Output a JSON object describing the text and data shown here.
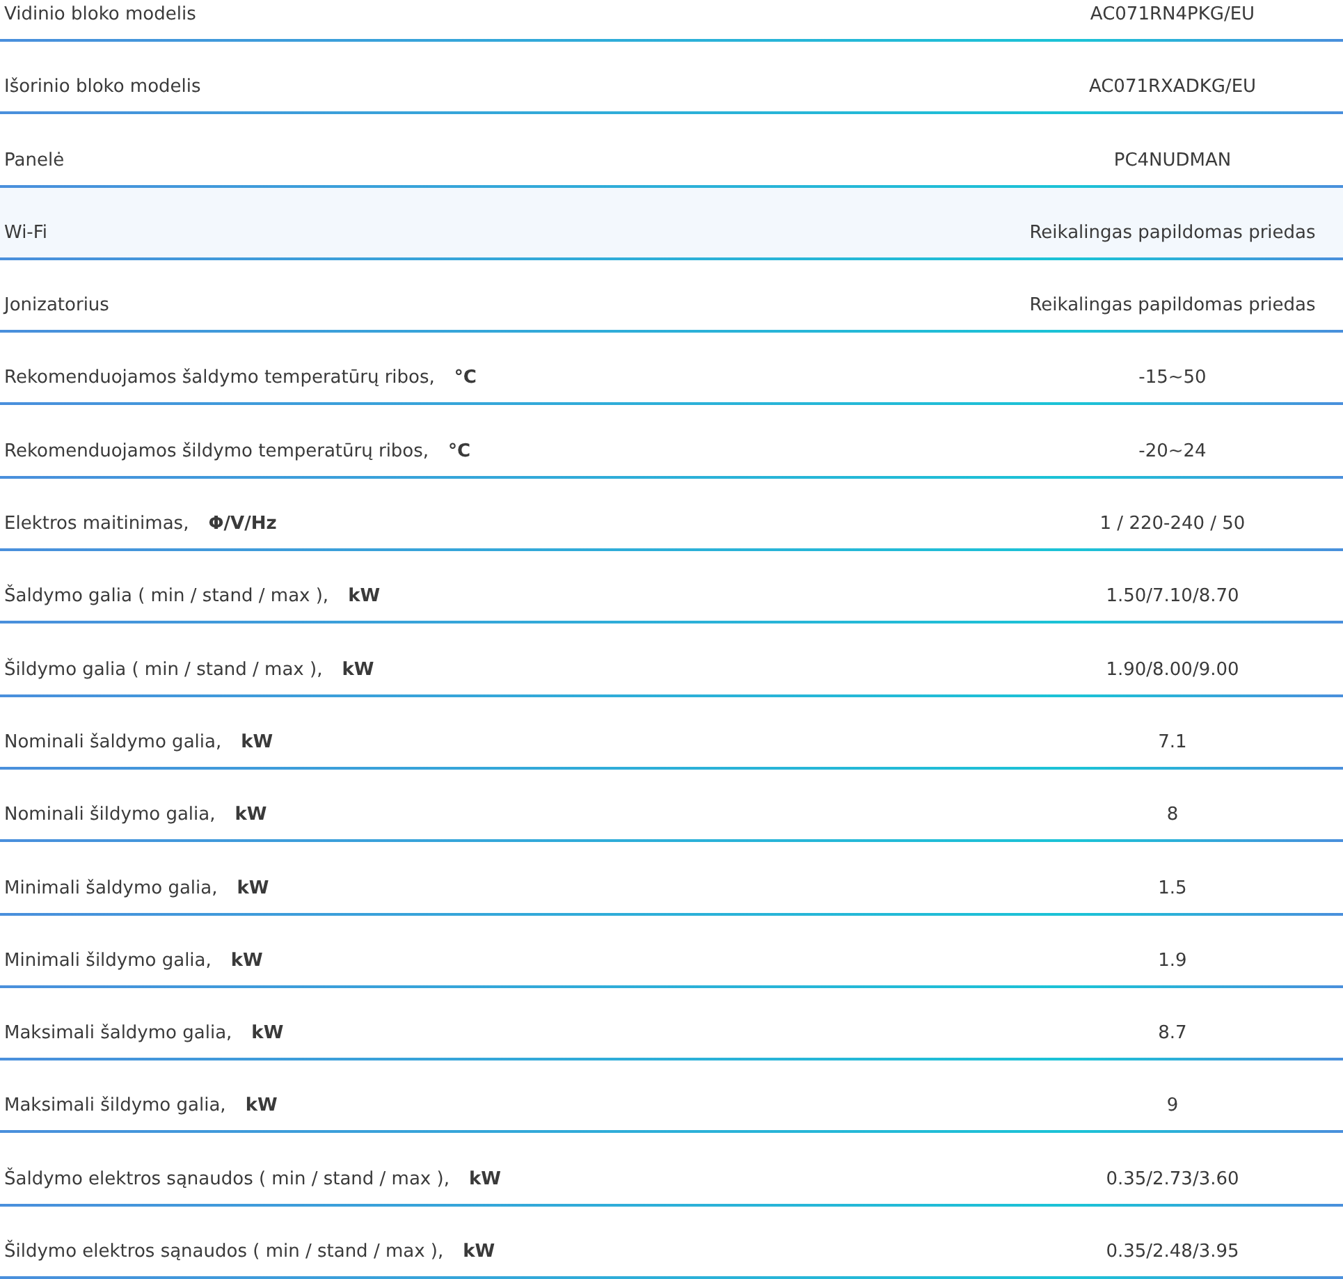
{
  "specs": [
    {
      "label": "Vidinio bloko modelis",
      "value": "AC071RN4PKG/EU",
      "highlighted": false
    },
    {
      "label": "Išorinio bloko modelis",
      "value": "AC071RXADKG/EU",
      "highlighted": false
    },
    {
      "label": "Panelė",
      "value": "PC4NUDMAN",
      "highlighted": false
    },
    {
      "label": "Wi-Fi",
      "value": "Reikalingas papildomas priedas",
      "highlighted": true
    },
    {
      "label": "Jonizatorius",
      "value": "Reikalingas papildomas priedas",
      "highlighted": false
    },
    {
      "label": "Rekomenduojamos šaldymo temperatūrų ribos,",
      "unit": "°C",
      "value": "-15~50",
      "highlighted": false
    },
    {
      "label": "Rekomenduojamos šildymo temperatūrų ribos,",
      "unit": "°C",
      "value": "-20~24",
      "highlighted": false
    },
    {
      "label": "Elektros maitinimas,",
      "unit": "Φ/V/Hz",
      "value": "1 / 220-240 / 50",
      "highlighted": false
    },
    {
      "label": "Šaldymo galia ( min / stand / max ),",
      "unit": "kW",
      "value": "1.50/7.10/8.70",
      "highlighted": false
    },
    {
      "label": "Šildymo galia ( min / stand / max ),",
      "unit": "kW",
      "value": "1.90/8.00/9.00",
      "highlighted": false
    },
    {
      "label": "Nominali šaldymo galia,",
      "unit": "kW",
      "value": "7.1",
      "highlighted": false
    },
    {
      "label": "Nominali šildymo galia,",
      "unit": "kW",
      "value": "8",
      "highlighted": false
    },
    {
      "label": "Minimali šaldymo galia,",
      "unit": "kW",
      "value": "1.5",
      "highlighted": false
    },
    {
      "label": "Minimali šildymo galia,",
      "unit": "kW",
      "value": "1.9",
      "highlighted": false
    },
    {
      "label": "Maksimali šaldymo galia,",
      "unit": "kW",
      "value": "8.7",
      "highlighted": false
    },
    {
      "label": "Maksimali šildymo galia,",
      "unit": "kW",
      "value": "9",
      "highlighted": false
    },
    {
      "label": "Šaldymo elektros sąnaudos ( min / stand / max ),",
      "unit": "kW",
      "value": "0.35/2.73/3.60",
      "highlighted": false
    },
    {
      "label": "Šildymo elektros sąnaudos ( min / stand / max ),",
      "unit": "kW",
      "value": "0.35/2.48/3.95",
      "highlighted": false
    }
  ]
}
